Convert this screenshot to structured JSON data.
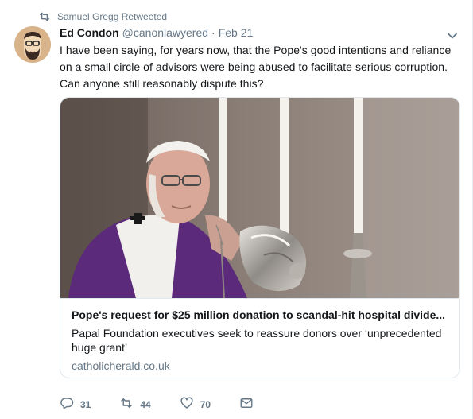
{
  "retweet": {
    "label": "Samuel Gregg Retweeted"
  },
  "author": {
    "name": "Ed Condon",
    "handle": "@canonlawyered",
    "separator": "·",
    "date": "Feb 21"
  },
  "tweet": {
    "text": "I have been saying, for years now, that the Pope's good intentions and reliance on a small circle of advisors were being abused to facilitate serious corruption. Can anyone still reasonably dispute this?"
  },
  "card": {
    "title": "Pope's request for $25 million donation to scandal-hit hospital divide...",
    "description": "Papal Foundation executives seek to reassure donors over ‘unprecedented huge grant’",
    "domain": "catholicherald.co.uk"
  },
  "actions": {
    "reply_count": "31",
    "retweet_count": "44",
    "like_count": "70"
  },
  "icons": {
    "retweet": "retweet-icon",
    "caret": "chevron-down-icon",
    "reply": "reply-icon",
    "like": "heart-icon",
    "dm": "envelope-icon"
  },
  "colors": {
    "muted": "#657786",
    "text": "#14171a",
    "border": "#e1e8ed",
    "vestment": "#5b2a7a"
  }
}
